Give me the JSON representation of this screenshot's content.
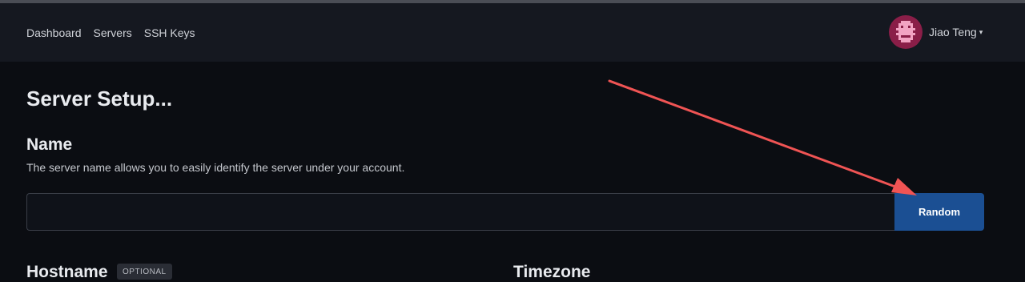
{
  "nav": {
    "links": [
      "Dashboard",
      "Servers",
      "SSH Keys"
    ],
    "user_name": "Jiao Teng",
    "caret": "▾"
  },
  "page": {
    "title": "Server Setup...",
    "name_section": {
      "title": "Name",
      "description": "The server name allows you to easily identify the server under your account.",
      "input_value": "",
      "button_label": "Random"
    },
    "hostname_section": {
      "title": "Hostname",
      "badge": "OPTIONAL"
    },
    "timezone_section": {
      "title": "Timezone"
    }
  },
  "colors": {
    "background": "#0b0d12",
    "navbar": "#151820",
    "button": "#1b4f93",
    "avatar": "#8a1e48",
    "annotation_arrow": "#f05454"
  },
  "icons": {
    "avatar": "pixel-identicon",
    "dropdown": "caret-down-icon",
    "annotation": "red-arrow-pointer"
  }
}
